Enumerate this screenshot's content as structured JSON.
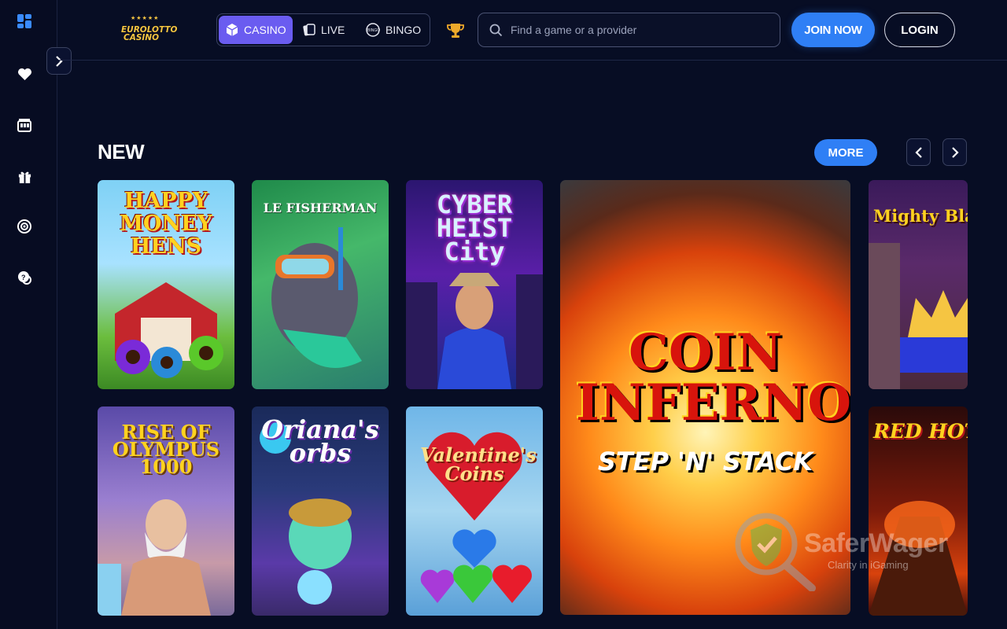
{
  "brand": {
    "logo_line1": "EUROLOTTO",
    "logo_line2": "CASINO"
  },
  "header": {
    "categories": [
      {
        "label": "CASINO",
        "icon": "cube-icon",
        "active": true
      },
      {
        "label": "LIVE",
        "icon": "cards-icon",
        "active": false
      },
      {
        "label": "BINGO",
        "icon": "bingo-ball-icon",
        "active": false
      }
    ],
    "search_placeholder": "Find a game or a provider",
    "join_label": "JOIN NOW",
    "login_label": "LOGIN"
  },
  "sidebar": {
    "items": [
      "dashboard-icon",
      "heart-icon",
      "slot-machine-icon",
      "gift-icon",
      "target-icon",
      "chat-help-icon"
    ]
  },
  "section": {
    "title": "NEW",
    "more_label": "MORE"
  },
  "games": [
    {
      "title": "HAPPY MONEY HENS"
    },
    {
      "title": "LE FISHERMAN"
    },
    {
      "title": "CYBER HEIST City"
    },
    {
      "title": "COIN INFERNO",
      "subtitle": "STEP 'N' STACK"
    },
    {
      "title": "Mighty Black Knig"
    },
    {
      "title": "RISE OF OLYMPUS 1000"
    },
    {
      "title": "Oriana's orbs"
    },
    {
      "title": "Valentine's Coins"
    },
    {
      "title": "RED HOT ERUPTIO"
    }
  ],
  "watermark": {
    "title": "SaferWager",
    "sub": "Clarity in iGaming"
  },
  "colors": {
    "accent": "#2f7ff5",
    "active_tab": "#6a5cf0",
    "background": "#070d24"
  }
}
